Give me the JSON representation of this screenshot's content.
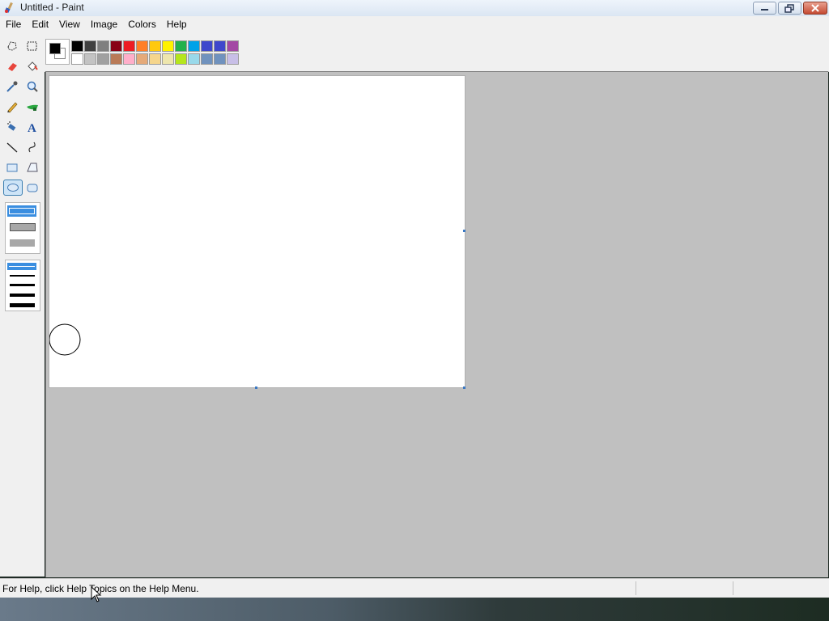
{
  "window": {
    "title": "Untitled - Paint"
  },
  "menu": [
    "File",
    "Edit",
    "View",
    "Image",
    "Colors",
    "Help"
  ],
  "tools": [
    {
      "name": "free-form-select-icon"
    },
    {
      "name": "select-icon"
    },
    {
      "name": "eraser-icon"
    },
    {
      "name": "fill-bucket-icon"
    },
    {
      "name": "pick-color-icon"
    },
    {
      "name": "magnifier-icon"
    },
    {
      "name": "pencil-icon"
    },
    {
      "name": "brush-icon"
    },
    {
      "name": "airbrush-icon"
    },
    {
      "name": "text-icon",
      "glyph": "A"
    },
    {
      "name": "line-icon"
    },
    {
      "name": "curve-icon"
    },
    {
      "name": "rectangle-icon"
    },
    {
      "name": "polygon-icon"
    },
    {
      "name": "ellipse-icon",
      "selected": true
    },
    {
      "name": "rounded-rectangle-icon"
    }
  ],
  "palette": {
    "foreground": "#000000",
    "background": "#ffffff",
    "row1": [
      "#000000",
      "#404040",
      "#7f7f7f",
      "#880015",
      "#ed1c24",
      "#ff7f27",
      "#ffc90e",
      "#fff200",
      "#22b14c",
      "#00a2e8",
      "#3f48cc",
      "#3f48cc",
      "#a349a4"
    ],
    "row2": [
      "#ffffff",
      "#c3c3c3",
      "#a0a0a0",
      "#b97a57",
      "#ffaec9",
      "#e5aa7a",
      "#f5d58c",
      "#eee6ad",
      "#b5e61d",
      "#99d9ea",
      "#7092be",
      "#7092be",
      "#c8bfe7"
    ]
  },
  "status": {
    "help_text": "For Help, click Help Topics on the Help Menu."
  },
  "colors": {
    "accent": "#3c7fb1",
    "workspace": "#c0c0c0"
  }
}
